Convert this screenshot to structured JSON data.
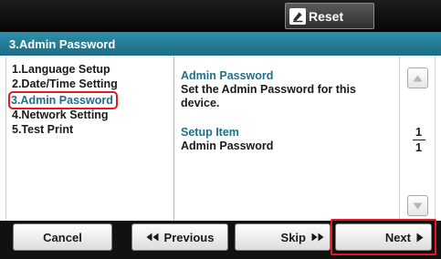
{
  "header": {
    "reset_label": "Reset",
    "reset_icon": "pencil-eraser-icon"
  },
  "title": "3.Admin Password",
  "menu": {
    "items": [
      {
        "label": "1.Language Setup",
        "selected": false
      },
      {
        "label": "2.Date/Time Setting",
        "selected": false
      },
      {
        "label": "3.Admin Password",
        "selected": true
      },
      {
        "label": "4.Network Setting",
        "selected": false
      },
      {
        "label": "5.Test Print",
        "selected": false
      }
    ]
  },
  "detail": {
    "heading": "Admin Password",
    "description_line1": "Set the Admin Password for this",
    "description_line2": "device.",
    "setup_heading": "Setup Item",
    "setup_value": "Admin Password"
  },
  "pagination": {
    "current": "1",
    "total": "1"
  },
  "footer": {
    "cancel_label": "Cancel",
    "previous_label": "Previous",
    "skip_label": "Skip",
    "next_label": "Next"
  },
  "colors": {
    "title_bar": "#2683a0",
    "accent_text": "#1f6f8b",
    "highlight": "#e01b24"
  }
}
